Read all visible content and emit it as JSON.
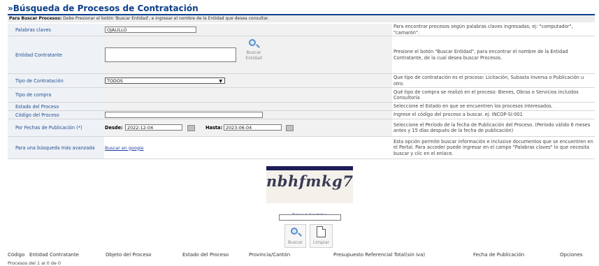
{
  "page_title": "»Búsqueda de Procesos de Contratación",
  "instructions": {
    "prefix": "Para Buscar Procesos:",
    "text": " Debe Presionar el botón 'Buscar Entidad', e ingresar el nombre de la Entidad que desea consultar."
  },
  "form": {
    "keywords": {
      "label": "Palabras claves",
      "value": "OJALILLO",
      "help": "Para encontrar procesos según palabras claves ingresadas; ej: \"computador\", \"camarón\"."
    },
    "entity": {
      "label": "Entidad Contratante",
      "value": "",
      "button_label_1": "Buscar",
      "button_label_2": "Entidad",
      "help": "Presione el botón \"Buscar Entidad\", para encontrar el nombre de la Entidad Contratante, de la cual desea buscar Procesos."
    },
    "contract_type": {
      "label": "Tipo de Contratación",
      "selected": "TODOS",
      "help": "Que tipo de contratación es el proceso: Licitación, Subasta Inversa o Publicación u otro."
    },
    "purchase_type": {
      "label": "Tipo de compra",
      "help": "Qué tipo de compra se realizó en el proceso: Bienes, Obras o Servicios incluidos Consultoría"
    },
    "process_state": {
      "label": "Estado del Proceso",
      "help": "Seleccione el Estado en que se encuentren los procesos interesados."
    },
    "process_code": {
      "label": "Código del Proceso",
      "value": "",
      "help": "Ingrese el código del proceso a buscar. ej: INCOP-SI-001"
    },
    "dates": {
      "label": "Por Fechas de Publicación (*)",
      "from_label": "Desde:",
      "from_value": "2022-12-04",
      "to_label": "Hasta:",
      "to_value": "2023-06-04",
      "help": "Seleccione el Período de la fecha de Publicación del Proceso. (Periodo válido 6 meses antes y 15 días después de la fecha de publicación)"
    },
    "advanced": {
      "label": "Para una búsqueda más avanzada",
      "link": "Buscar en google",
      "help": "Esta opción permite buscar información e inclusive documentos que se encuentren en el Portal. Para acceder puede ingresar en el campo \"Palabras claves\" lo que necesita buscar y clic en el enlace."
    }
  },
  "captcha": {
    "text": "nbhfmkg7",
    "reload_label": "Reload Captcha",
    "input_value": ""
  },
  "actions": {
    "search_label": "Buscar",
    "clear_label": "Limpiar"
  },
  "results": {
    "columns": [
      "Código",
      "Entidad Contratante",
      "Objeto del Proceso",
      "Estado del Proceso",
      "Provincia/Cantón",
      "Presupuesto Referencial Total(sin iva)",
      "Fecha de Publicación",
      "Opciones"
    ],
    "count_text": "Procesos del 1 al 0 de 0"
  },
  "colors": {
    "title": "#0d3f8a",
    "label_bg": "#eef1f6",
    "link": "#1f3f9f",
    "captcha_bar": "#1e1b5a"
  }
}
